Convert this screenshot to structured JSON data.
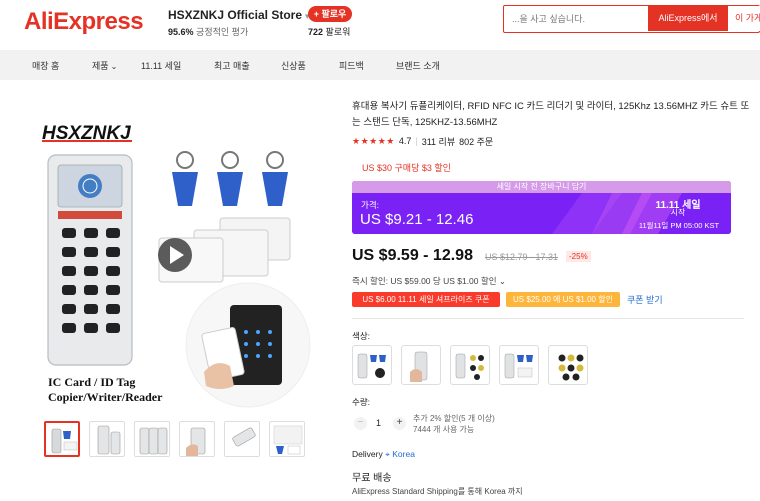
{
  "header": {
    "logo": "AliExpress",
    "store_name": "HSXZNKJ Official Store",
    "store_rating_pct": "95.6%",
    "store_rating_text": "긍정적인 평가",
    "follow_label": "+ 팔로우",
    "followers_count": "722",
    "followers_label": "팔로워",
    "search_placeholder": "...을 사고 싶습니다.",
    "search_ali_label": "AliExpress에서",
    "search_other_label": "이 가게"
  },
  "nav": {
    "items": [
      "매장 홈",
      "제품",
      "11.11 세일",
      "최고 매출",
      "신상품",
      "피드백",
      "브랜드 소개"
    ]
  },
  "gallery": {
    "brand_text": "HSXZNKJ",
    "caption_line1": "IC Card / ID Tag",
    "caption_line2": "Copier/Writer/Reader",
    "thumb_count": 6
  },
  "product": {
    "title": "휴대용 복사기 듀플리케이터, RFID NFC IC 카드 리더기 및 라이터, 125Khz 13.56MHZ 카드 슈트 또는 스탠드 단독, 125KHZ-13.56MHZ",
    "rating": "4.7",
    "reviews": "311 리뷰",
    "orders": "802 주문",
    "store_coupon": "US $30 구매당 $3 할인"
  },
  "promo": {
    "top_text": "세일 시작 전 장바구니 담기",
    "label": "가격:",
    "price": "US $9.21 - 12.46",
    "event": "11.11 세일",
    "start": "시작",
    "date": "11월11일 PM 05:00 KST"
  },
  "price": {
    "current": "US $9.59 - 12.98",
    "original": "US $12.79 - 17.31",
    "discount": "-25%",
    "instant": "즉시 할인: US $59.00 당 US $1.00 할인 ⌄",
    "coupon1": "US $6.00 11.11 세일 셔프라이즈 쿠폰",
    "coupon2": "US $25.00 에 US $1.00 할인",
    "coupon_link": "쿠폰 받기"
  },
  "options": {
    "color_label": "색상:",
    "swatch_count": 5,
    "qty_label": "수량:",
    "qty_value": "1",
    "qty_note1": "추가 2% 할인(5 개 이상)",
    "qty_note2": "7444 개 사용 가능"
  },
  "delivery": {
    "label": "Delivery",
    "location": "Korea",
    "free_shipping": "무료 배송",
    "ship_desc": "AliExpress Standard Shipping를 통해 Korea 까지"
  },
  "colors": {
    "brand_red": "#e43225",
    "promo_purple": "#7a22f6",
    "coupon_red": "#fa3b2c",
    "coupon_orange": "#fdb63b",
    "link_blue": "#1e6cd3"
  }
}
